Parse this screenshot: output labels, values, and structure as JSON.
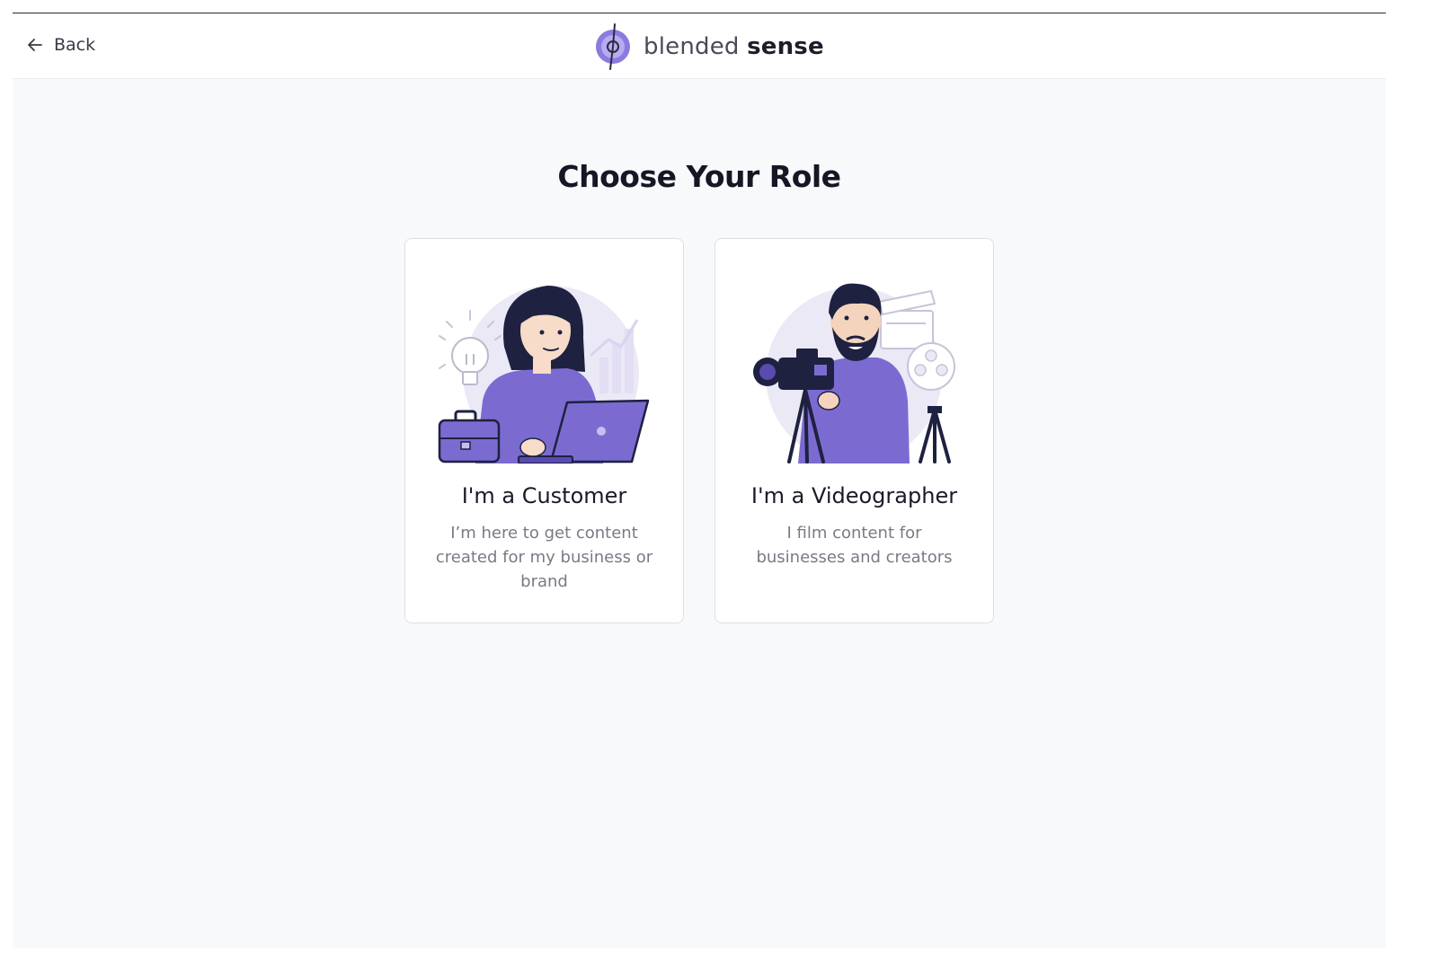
{
  "header": {
    "back_label": "Back",
    "logo_text_light": "blended",
    "logo_text_bold": "sense"
  },
  "page": {
    "title": "Choose Your Role"
  },
  "roles": [
    {
      "title": "I'm a Customer",
      "description": "I’m here to get content created for my business or brand",
      "illustration": "woman-with-laptop-illustration"
    },
    {
      "title": "I'm a Videographer",
      "description": "I film content for businesses and creators",
      "illustration": "man-with-camera-illustration"
    }
  ],
  "colors": {
    "accent": "#7b6bd1",
    "accent_dark": "#5a4bb0",
    "ink": "#1e2140",
    "page_bg": "#f8f9fb",
    "card_border": "#dedee6"
  }
}
